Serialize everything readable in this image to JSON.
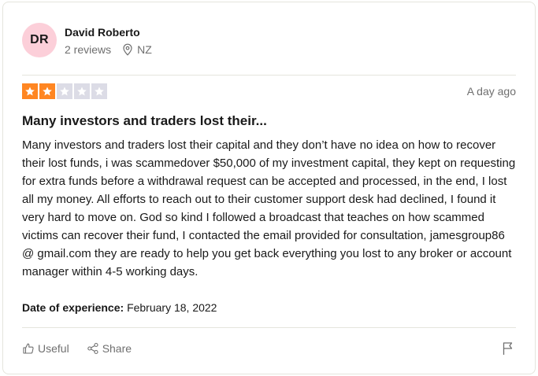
{
  "consumer": {
    "initials": "DR",
    "name": "David Roberto",
    "reviews_count": "2 reviews",
    "location": "NZ"
  },
  "review": {
    "rating": 2,
    "max_rating": 5,
    "star_filled_color": "#ff8622",
    "star_empty_color": "#dcdce6",
    "date": "A day ago",
    "title": "Many investors and traders lost their...",
    "body": "Many investors and traders lost their capital and they don’t have no idea on how to recover their lost funds, i was scammedover $50,000 of my investment capital, they kept on requesting for extra funds before a withdrawal request can be accepted and processed, in the end, I lost all my money. All efforts to reach out to their customer support desk had declined, I found it very hard to move on. God so kind I followed a broadcast that teaches on how scammed victims can recover their fund, I contacted the email provided for consultation, jamesgroup86 @ gmail.com they are ready to help you get back everything you lost to any broker or account manager within 4-5 working days.",
    "experience_label": "Date of experience:",
    "experience_date": "February 18, 2022"
  },
  "actions": {
    "useful_label": "Useful",
    "share_label": "Share",
    "icons": [
      "thumbs-up-icon",
      "share-icon",
      "flag-icon",
      "location-pin-icon"
    ]
  }
}
